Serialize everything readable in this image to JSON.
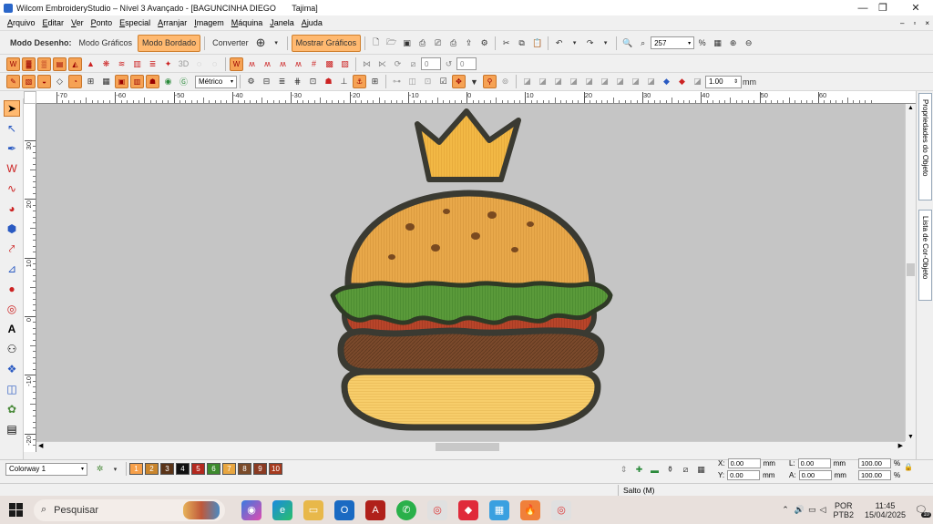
{
  "window": {
    "title": "Wilcom EmbroideryStudio – Nível 3 Avançado - [BAGUNCINHA DIEGO       Tajima]",
    "minimize_icon": "—",
    "restore_icon": "❐",
    "close_icon": "✕"
  },
  "menu": {
    "items": [
      "Arquivo",
      "Editar",
      "Ver",
      "Ponto",
      "Especial",
      "Arranjar",
      "Imagem",
      "Máquina",
      "Janela",
      "Ajuda"
    ],
    "mdi_min": "–",
    "mdi_restore": "▫",
    "mdi_close": "×"
  },
  "toolbar1": {
    "mode_label": "Modo Desenho:",
    "graphics_mode": "Modo Gráficos",
    "embroidery_mode": "Modo Bordado",
    "convert": "Converter",
    "show_graphics": "Mostrar Gráficos",
    "zoom_value": "257",
    "zoom_percent": "%"
  },
  "toolbar2": {
    "angle1": "0",
    "angle2": "0"
  },
  "toolbar3": {
    "units": "Métrico",
    "width_value": "1.00",
    "width_unit": "mm"
  },
  "ruler": {
    "h_ticks": [
      "-70",
      "-60",
      "-50",
      "-40",
      "-30",
      "-20",
      "-10",
      "0",
      "10",
      "20",
      "30",
      "40",
      "50",
      "60"
    ],
    "v_ticks": [
      "30",
      "20",
      "10",
      "0",
      "-10",
      "-20",
      "-30"
    ]
  },
  "right_panel": {
    "tab1": "Propriedades do Objeto",
    "tab2": "Lista de Cor-Objeto"
  },
  "colorbar": {
    "colorway": "Colorway 1",
    "swatches": [
      {
        "label": "1",
        "color": "#f7a04a"
      },
      {
        "label": "2",
        "color": "#c9852d"
      },
      {
        "label": "3",
        "color": "#5a3418"
      },
      {
        "label": "4",
        "color": "#111111"
      },
      {
        "label": "5",
        "color": "#b3281e"
      },
      {
        "label": "6",
        "color": "#3d8a2e"
      },
      {
        "label": "7",
        "color": "#e8a640"
      },
      {
        "label": "8",
        "color": "#7a4b2a"
      },
      {
        "label": "9",
        "color": "#8a3a22"
      },
      {
        "label": "10",
        "color": "#a63a1e"
      }
    ]
  },
  "coords": {
    "x_label": "X:",
    "x_value": "0.00",
    "x_unit": "mm",
    "y_label": "Y:",
    "y_value": "0.00",
    "y_unit": "mm",
    "l_label": "L:",
    "l_value": "0.00",
    "l_unit": "mm",
    "a_label": "A:",
    "a_value": "0.00",
    "a_unit": "mm",
    "pct1": "100.00",
    "pct2": "100.00",
    "pct_sign": "%"
  },
  "status": {
    "text": "Salto (M)"
  },
  "taskbar": {
    "search_placeholder": "Pesquisar",
    "lang": "POR",
    "lang2": "PTB2",
    "time": "11:45",
    "date": "15/04/2025",
    "notification_count": "10"
  }
}
